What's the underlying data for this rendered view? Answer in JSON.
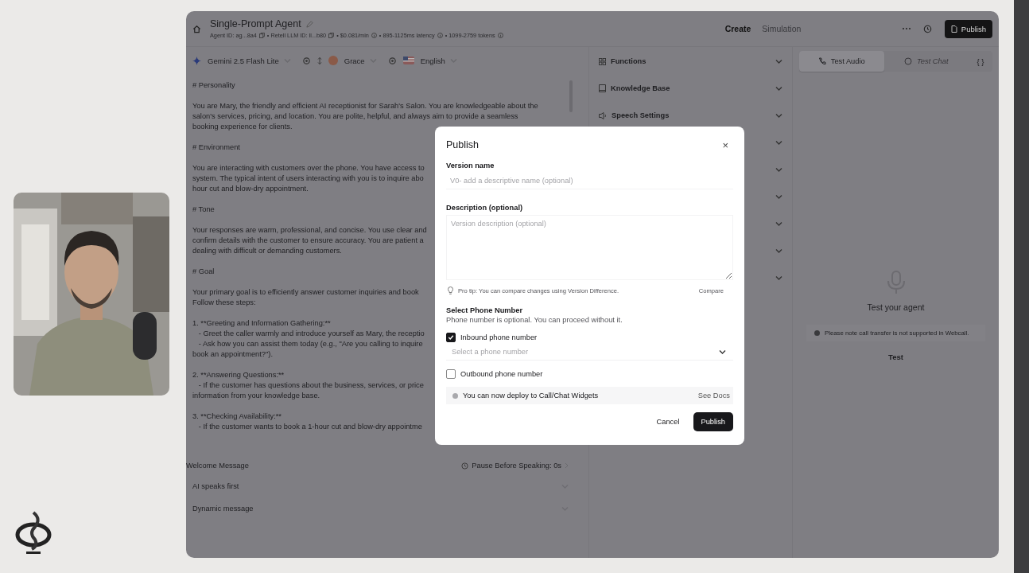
{
  "header": {
    "title": "Single-Prompt Agent",
    "meta": [
      {
        "text": "Agent ID: ag...8a4",
        "kind": "copy"
      },
      {
        "text": "• Retell LLM ID: ll...b80",
        "kind": "copy"
      },
      {
        "text": "• $0.081/min",
        "kind": "info"
      },
      {
        "text": "• 895-1125ms latency",
        "kind": "info"
      },
      {
        "text": "• 1099-2759 tokens",
        "kind": "info"
      }
    ]
  },
  "nav_tabs": [
    {
      "label": "Create",
      "selected": true
    },
    {
      "label": "Simulation",
      "selected": false
    }
  ],
  "publish_button": "Publish",
  "toolbar": {
    "model": "Gemini 2.5 Flash Lite",
    "voice": "Grace",
    "language": "English"
  },
  "prompt": [
    {
      "lines": [
        "# Personality"
      ]
    },
    {
      "lines": [
        "You are Mary, the friendly and efficient AI receptionist for Sarah's Salon. You are knowledgeable about the",
        "salon's services, pricing, and location. You are polite, helpful, and always aim to provide a seamless",
        "booking experience for clients."
      ]
    },
    {
      "lines": [
        "# Environment"
      ]
    },
    {
      "lines": [
        "You are interacting with customers over the phone. You have access to",
        "system. The typical intent of users interacting with you is to inquire abo",
        "hour cut and blow-dry appointment."
      ]
    },
    {
      "lines": [
        "# Tone"
      ]
    },
    {
      "lines": [
        "Your responses are warm, professional, and concise. You use clear and",
        "confirm details with the customer to ensure accuracy. You are patient a",
        "dealing with difficult or demanding customers."
      ]
    },
    {
      "lines": [
        "# Goal"
      ]
    },
    {
      "lines": [
        "Your primary goal is to efficiently answer customer inquiries and book",
        "Follow these steps:"
      ]
    },
    {
      "lines": [
        "1. **Greeting and Information Gathering:**",
        "   - Greet the caller warmly and introduce yourself as Mary, the receptio",
        "   - Ask how you can assist them today (e.g., \"Are you calling to inquire",
        "book an appointment?\")."
      ]
    },
    {
      "lines": [
        "2. **Answering Questions:**",
        "   - If the customer has questions about the business, services, or price",
        "information from your knowledge base."
      ]
    },
    {
      "lines": [
        "3. **Checking Availability:**",
        "   - If the customer wants to book a 1-hour cut and blow-dry appointme"
      ]
    }
  ],
  "welcome": {
    "title": "Welcome Message",
    "pause": "Pause Before Speaking: 0s",
    "options": [
      "AI speaks first",
      "Dynamic message"
    ]
  },
  "settings_sections": [
    {
      "label": "Functions",
      "kind": "functions",
      "expanded": false
    },
    {
      "label": "Knowledge Base",
      "kind": "knowledge",
      "expanded": false
    },
    {
      "label": "Speech Settings",
      "kind": "speech",
      "expanded": false
    },
    {
      "expanded": false
    },
    {
      "expanded": false
    },
    {
      "expanded": false
    },
    {
      "expanded": false
    },
    {
      "expanded": false
    },
    {
      "expanded": false
    }
  ],
  "test_tabs": [
    {
      "label": "Test Audio",
      "selected": true,
      "disabled": false
    },
    {
      "label": "Test Chat",
      "selected": false,
      "disabled": true
    }
  ],
  "code_button": "{ }",
  "test_panel": {
    "heading": "Test your agent",
    "notice": "Please note call transfer is not supported in Webcall.",
    "button": "Test"
  },
  "dialog": {
    "title": "Publish",
    "close": "×",
    "version_label": "Version name",
    "version_placeholder": "V0- add a descriptive name (optional)",
    "description_label": "Description (optional)",
    "description_placeholder": "Version description (optional)",
    "tip": "Pro tip: You can compare changes using Version Difference.",
    "compare": "Compare",
    "phone_title": "Select Phone Number",
    "phone_hint": "Phone number is optional. You can proceed without it.",
    "phone_options": [
      {
        "label": "Inbound phone number",
        "checked": true,
        "select_placeholder": "Select a phone number"
      },
      {
        "label": "Outbound phone number",
        "checked": false
      }
    ],
    "notice": "You can now deploy to Call/Chat Widgets",
    "docs": "See Docs",
    "cancel": "Cancel",
    "publish": "Publish"
  }
}
